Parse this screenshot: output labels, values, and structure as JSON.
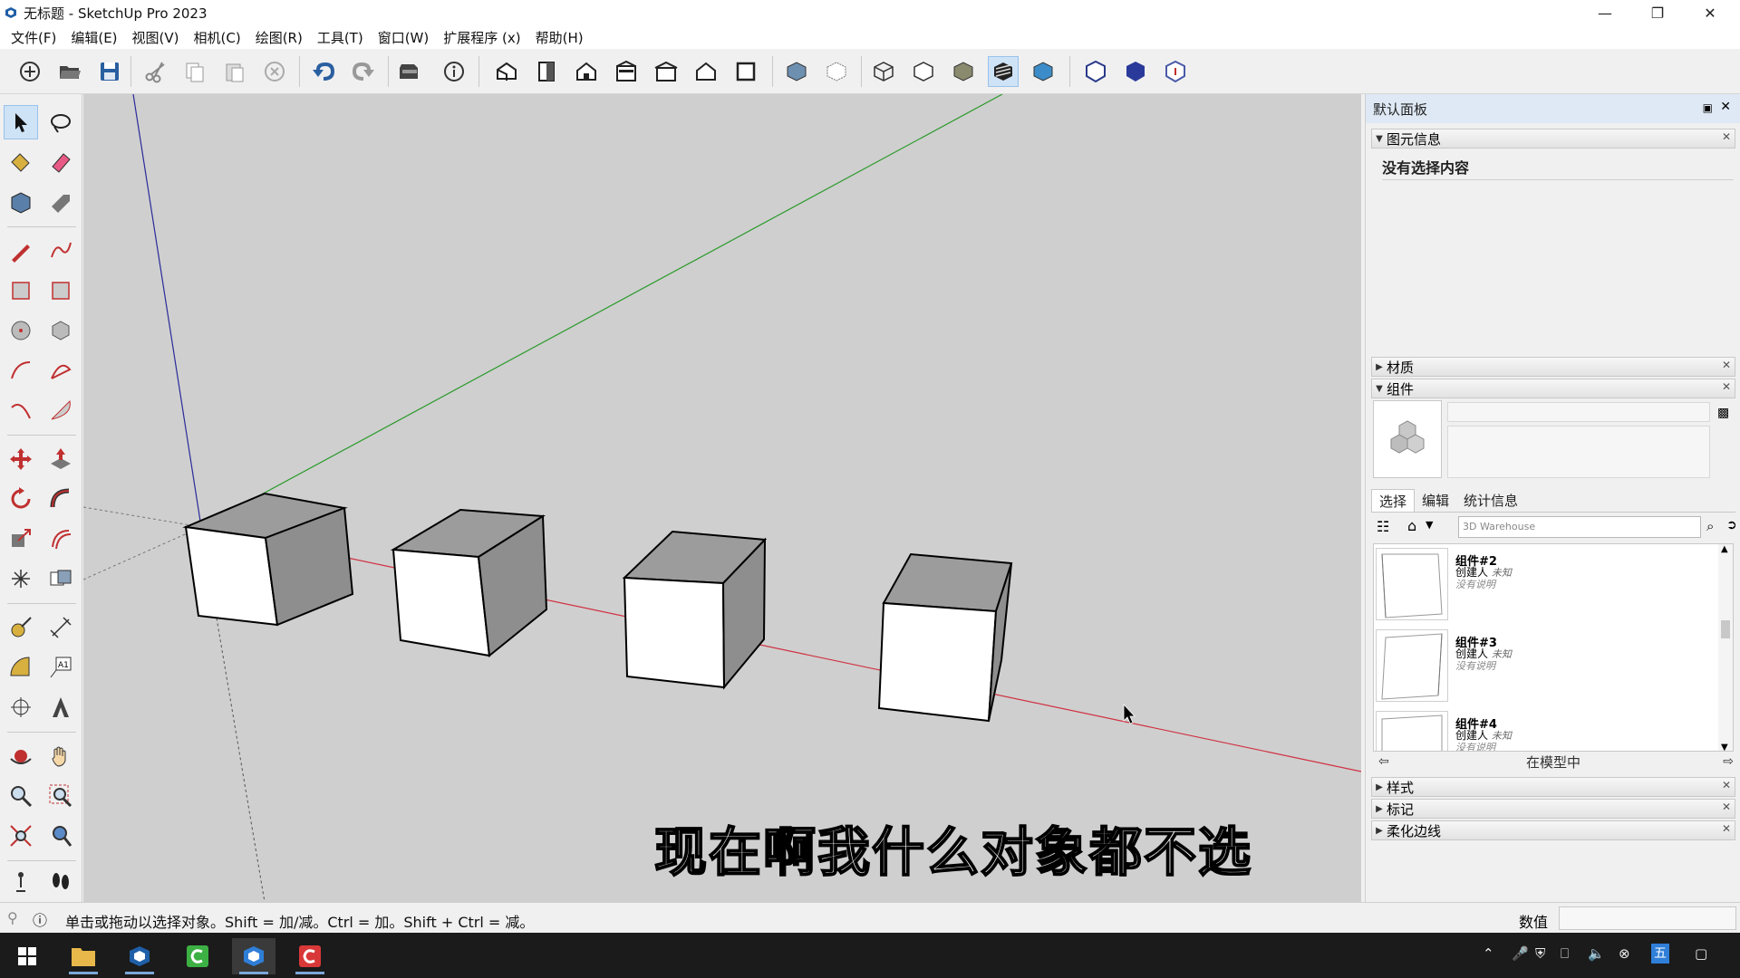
{
  "window": {
    "title": "无标题 - SketchUp Pro 2023",
    "minimize_icon": "minimize-icon",
    "maximize_icon": "restore-icon",
    "close_icon": "close-icon"
  },
  "menu": [
    "文件(F)",
    "编辑(E)",
    "视图(V)",
    "相机(C)",
    "绘图(R)",
    "工具(T)",
    "窗口(W)",
    "扩展程序 (x)",
    "帮助(H)"
  ],
  "viewport": {
    "subtitle": "现在啊我什么对象都不选",
    "axis_colors": {
      "red": "#d03040",
      "green": "#2a9a2a",
      "blue": "#2a2a9a"
    },
    "background": "#cfcfcf"
  },
  "right_panel": {
    "title": "默认面板",
    "entity_info": {
      "label": "图元信息",
      "message": "没有选择内容"
    },
    "materials": {
      "label": "材质"
    },
    "components": {
      "label": "组件",
      "tabs": [
        "选择",
        "编辑",
        "统计信息"
      ],
      "search_placeholder": "3D Warehouse",
      "items": [
        {
          "name": "组件#2",
          "creator_label": "创建人",
          "creator": "未知",
          "desc": "没有说明"
        },
        {
          "name": "组件#3",
          "creator_label": "创建人",
          "creator": "未知",
          "desc": "没有说明"
        },
        {
          "name": "组件#4",
          "creator_label": "创建人",
          "creator": "未知",
          "desc": "没有说明"
        }
      ],
      "in_model": "在模型中"
    },
    "styles": {
      "label": "样式"
    },
    "tags": {
      "label": "标记"
    },
    "soften": {
      "label": "柔化边线"
    }
  },
  "status": {
    "text": "单击或拖动以选择对象。Shift = 加/减。Ctrl = 加。Shift + Ctrl = 减。",
    "measure_label": "数值",
    "measure_value": ""
  }
}
